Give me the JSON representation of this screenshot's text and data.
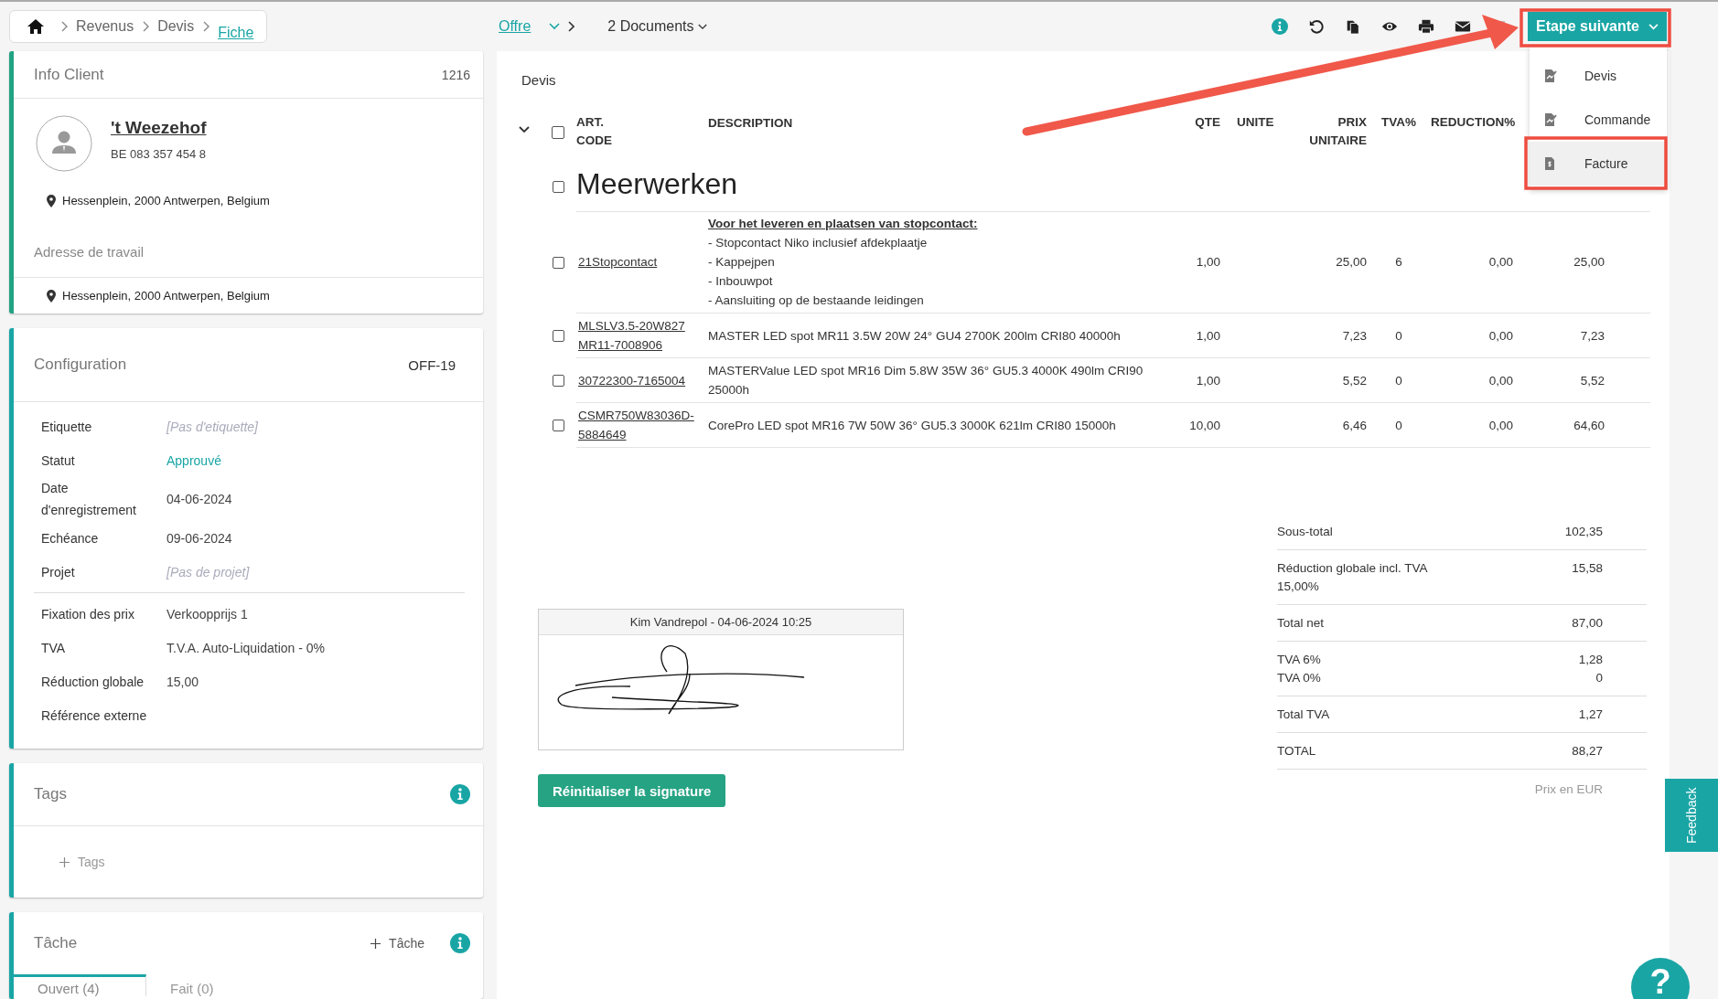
{
  "breadcrumb": [
    {
      "label": "Revenus",
      "current": false
    },
    {
      "label": "Devis",
      "current": false
    },
    {
      "label": "Fiche",
      "current": true
    }
  ],
  "document_nav": {
    "type": "Offre",
    "documents": "2 Documents"
  },
  "next_step": {
    "label": "Etape suivante",
    "menu": [
      {
        "label": "Devis",
        "kind": "signed",
        "selected": false
      },
      {
        "label": "Commande",
        "kind": "signed",
        "selected": false
      },
      {
        "label": "Facture",
        "kind": "invoice",
        "selected": true
      }
    ]
  },
  "client": {
    "title": "Info Client",
    "number": "1216",
    "name": "'t Weezehof",
    "vat": "BE 083 357 454 8",
    "address": "Hessenplein, 2000 Antwerpen, Belgium",
    "work_address_label": "Adresse de travail",
    "work_address": "Hessenplein, 2000 Antwerpen, Belgium"
  },
  "configuration": {
    "title": "Configuration",
    "code": "OFF-19",
    "groups": [
      [
        {
          "label": "Etiquette",
          "value": "[Pas d'etiquette]",
          "kind": "empty"
        },
        {
          "label": "Statut",
          "value": "Approuvé",
          "kind": "status"
        },
        {
          "label": "Date d'enregistrement",
          "value": "04-06-2024",
          "kind": "text"
        },
        {
          "label": "Echéance",
          "value": "09-06-2024",
          "kind": "text"
        },
        {
          "label": "Projet",
          "value": "[Pas de projet]",
          "kind": "empty"
        }
      ],
      [
        {
          "label": "Fixation des prix",
          "value": "Verkoopprijs 1",
          "kind": "text"
        },
        {
          "label": "TVA",
          "value": "T.V.A. Auto-Liquidation - 0%",
          "kind": "text"
        },
        {
          "label": "Réduction globale",
          "value": "15,00",
          "kind": "text"
        },
        {
          "label": "Référence externe"
        }
      ]
    ]
  },
  "tags": {
    "title": "Tags",
    "add": "Tags"
  },
  "tasks": {
    "title": "Tâche",
    "add": "Tâche",
    "tabs": [
      {
        "label": "Ouvert (4)",
        "selected": true
      },
      {
        "label": "Fait (0)",
        "selected": false
      }
    ]
  },
  "document": {
    "title": "Devis",
    "header_checked": false,
    "columns": [
      "ART. CODE",
      "DESCRIPTION",
      "QTE",
      "UNITE",
      "PRIX UNITAIRE",
      "TVA%",
      "REDUCTION%"
    ],
    "section": {
      "title": "Meerwerken",
      "checked": false
    },
    "rows": [
      {
        "checked": false,
        "code": "21Stopcontact",
        "description_heading": "Voor het leveren en plaatsen van stopcontact:",
        "description_lines": [
          "- Stopcontact Niko inclusief afdekplaatje",
          "- Kappejpen",
          "- Inbouwpot",
          "- Aansluiting op de bestaande leidingen"
        ],
        "qte": "1,00",
        "price": "25,00",
        "tva": "6",
        "reduction": "0,00",
        "total": "25,00"
      },
      {
        "checked": false,
        "code": "MLSLV3.5-20W827MR11-7008906",
        "description": "MASTER LED spot MR11 3.5W 20W 24° GU4 2700K 200lm CRI80 40000h",
        "qte": "1,00",
        "price": "7,23",
        "tva": "0",
        "reduction": "0,00",
        "total": "7,23"
      },
      {
        "checked": false,
        "code": "30722300-7165004",
        "description": "MASTERValue LED spot MR16 Dim 5.8W 35W 36° GU5.3 4000K 490lm CRI90 25000h",
        "qte": "1,00",
        "price": "5,52",
        "tva": "0",
        "reduction": "0,00",
        "total": "5,52"
      },
      {
        "checked": false,
        "code": "CSMR750W83036D-5884649",
        "description": "CorePro LED spot MR16 7W 50W 36° GU5.3 3000K 621lm CRI80 15000h",
        "qte": "10,00",
        "price": "6,46",
        "tva": "0",
        "reduction": "0,00",
        "total": "64,60"
      }
    ]
  },
  "signature": {
    "caption": "Kim Vandrepol - 04-06-2024 10:25",
    "reset_button": "Réinitialiser la signature"
  },
  "totals": [
    [
      {
        "label": "Sous-total",
        "value": "102,35"
      }
    ],
    [
      {
        "label": "Réduction globale incl. TVA",
        "note": "15,00%",
        "value": "15,58"
      }
    ],
    [
      {
        "label": "Total net",
        "value": "87,00"
      }
    ],
    [
      {
        "label": "TVA 6%",
        "value": "1,28"
      },
      {
        "label": "TVA 0%",
        "value": "0"
      }
    ],
    [
      {
        "label": "Total TVA",
        "value": "1,27"
      }
    ],
    [
      {
        "label": "TOTAL",
        "value": "88,27"
      }
    ]
  ],
  "currency_note": "Prix en EUR",
  "feedback": "Feedback",
  "help": "?"
}
